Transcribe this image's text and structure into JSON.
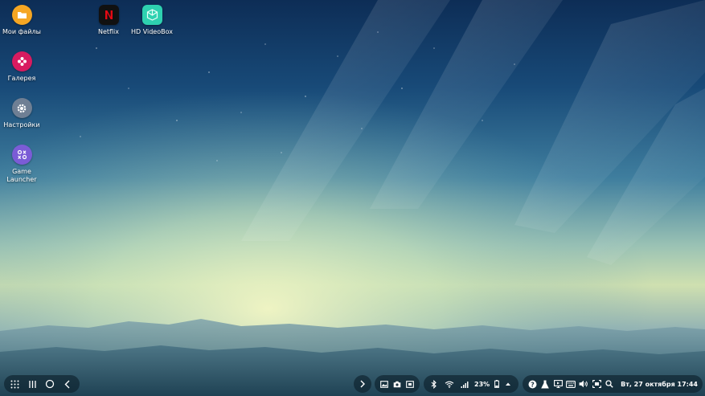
{
  "desktop": {
    "icons": [
      {
        "name": "my-files",
        "label": "Мои файлы",
        "icon": "folder-icon",
        "color": "#f5a623"
      },
      {
        "name": "netflix",
        "label": "Netflix",
        "icon": "netflix-icon",
        "color": "#000000"
      },
      {
        "name": "hd-videobox",
        "label": "HD VideoBox",
        "icon": "videobox-icon",
        "color": "#2ed1b0"
      },
      {
        "name": "gallery",
        "label": "Галерея",
        "icon": "flower-icon",
        "color": "#d81b60"
      },
      {
        "name": "settings",
        "label": "Настройки",
        "icon": "gear-icon",
        "color": "#6f7f94"
      },
      {
        "name": "game-launcher",
        "label": "Game\nLauncher",
        "icon": "game-launcher-icon",
        "color": "#7b5cd6"
      }
    ]
  },
  "taskbar": {
    "nav": [
      "apps-grid-icon",
      "recent-apps-icon",
      "home-icon",
      "back-icon"
    ],
    "expand_icon": "chevron-right-icon",
    "quick_tools": [
      "screenshot-icon",
      "camera-icon",
      "screen-record-icon"
    ],
    "status": {
      "battery_percent": "23%",
      "icons": [
        "bluetooth-icon",
        "wifi-icon",
        "signal-icon",
        "battery-icon",
        "chevron-up-icon"
      ]
    },
    "system_tray": [
      "help-icon",
      "lab-icon",
      "display-icon",
      "keyboard-icon",
      "volume-icon",
      "screen-capture-icon",
      "search-icon"
    ],
    "datetime": "Вт, 27 октября 17:44"
  }
}
